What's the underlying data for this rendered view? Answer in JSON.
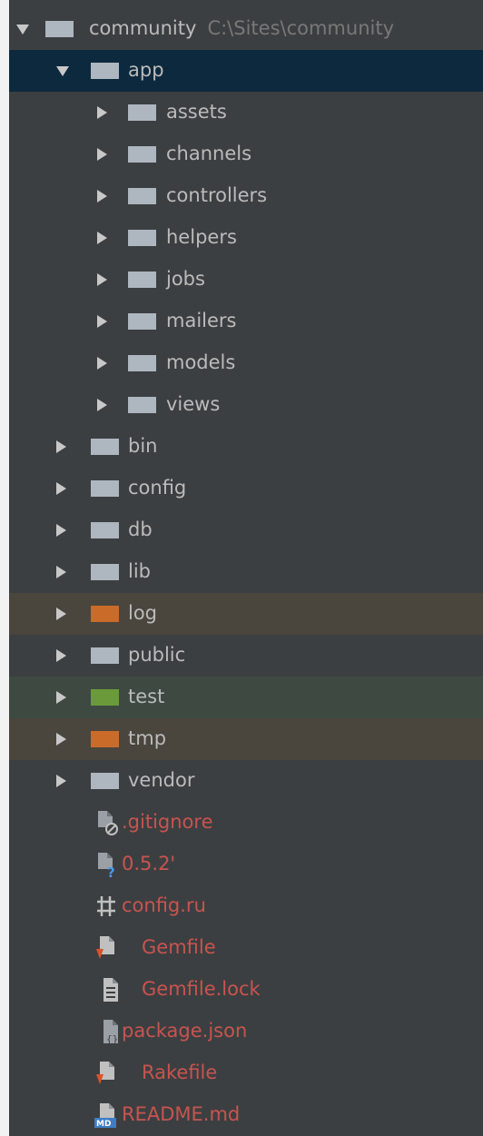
{
  "colors": {
    "background": "#3c3f41",
    "selected": "#0d293e",
    "excluded_row": "#4a463e",
    "test_row": "#3e4a41",
    "red_text": "#c75450"
  },
  "project": {
    "name": "community",
    "path": "C:\\Sites\\community"
  },
  "app": {
    "label": "app",
    "children": [
      "assets",
      "channels",
      "controllers",
      "helpers",
      "jobs",
      "mailers",
      "models",
      "views"
    ]
  },
  "folders": [
    "bin",
    "config",
    "db",
    "lib",
    "log",
    "public",
    "test",
    "tmp",
    "vendor"
  ],
  "files": [
    {
      "name": ".gitignore",
      "icon": "gitignore-icon"
    },
    {
      "name": "0.5.2'",
      "icon": "unknown-file-icon"
    },
    {
      "name": "config.ru",
      "icon": "hash-icon"
    },
    {
      "name": "Gemfile",
      "icon": "gemfile-icon"
    },
    {
      "name": "Gemfile.lock",
      "icon": "text-file-icon"
    },
    {
      "name": "package.json",
      "icon": "json-file-icon"
    },
    {
      "name": "Rakefile",
      "icon": "rakefile-icon"
    },
    {
      "name": "README.md",
      "icon": "markdown-icon"
    }
  ]
}
